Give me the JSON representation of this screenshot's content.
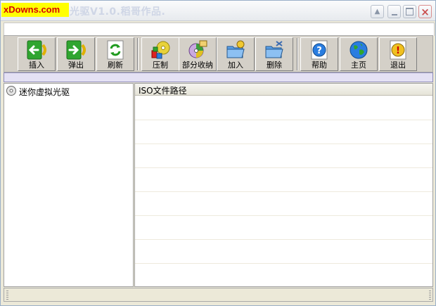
{
  "window": {
    "logo": "xDowns.com",
    "title": "光驱V1.0.稻哥作品."
  },
  "toolbar": {
    "buttons": [
      {
        "label": "插入",
        "icon": "insert-arrow-icon"
      },
      {
        "label": "弹出",
        "icon": "eject-arrow-icon"
      },
      {
        "label": "刷新",
        "icon": "refresh-icon"
      },
      {
        "label": "压制",
        "icon": "compress-disc-icon"
      },
      {
        "label": "部分收纳",
        "icon": "partial-collect-disc-icon"
      },
      {
        "label": "加入",
        "icon": "add-folder-icon"
      },
      {
        "label": "删除",
        "icon": "delete-folder-icon"
      },
      {
        "label": "帮助",
        "icon": "help-icon"
      },
      {
        "label": "主页",
        "icon": "homepage-globe-icon"
      },
      {
        "label": "退出",
        "icon": "exit-icon"
      }
    ]
  },
  "tree": {
    "root_label": "迷你虚拟光驱"
  },
  "list": {
    "column_header": "ISO文件路径"
  },
  "colors": {
    "logo_bg": "#ffff00",
    "logo_text": "#d40000",
    "toolbar_bg": "#d4d0c8",
    "band_bg": "#e4e1f4"
  }
}
